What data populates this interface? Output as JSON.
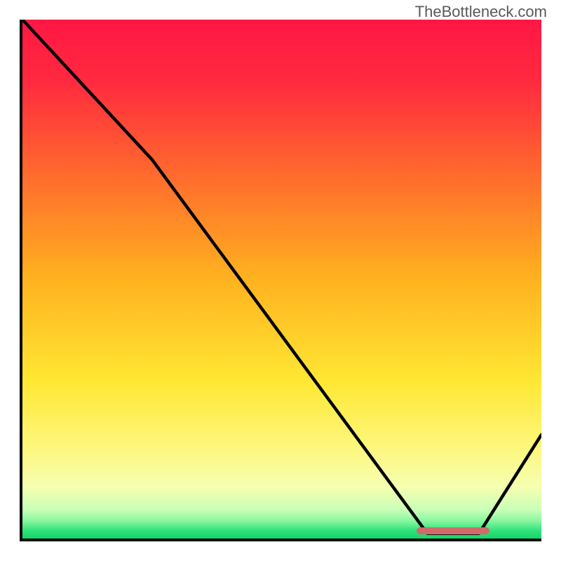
{
  "watermark": "TheBottleneck.com",
  "chart_data": {
    "type": "line",
    "title": "",
    "xlabel": "",
    "ylabel": "",
    "xlim": [
      0,
      100
    ],
    "ylim": [
      0,
      100
    ],
    "x": [
      0,
      25,
      78,
      88,
      100
    ],
    "values": [
      100,
      73,
      1,
      1,
      20
    ],
    "gradient_stops": [
      {
        "pos": 0.0,
        "color": "#ff1744"
      },
      {
        "pos": 0.12,
        "color": "#ff2a3f"
      },
      {
        "pos": 0.3,
        "color": "#ff6b2d"
      },
      {
        "pos": 0.5,
        "color": "#ffb21f"
      },
      {
        "pos": 0.7,
        "color": "#ffe834"
      },
      {
        "pos": 0.82,
        "color": "#fdf67a"
      },
      {
        "pos": 0.9,
        "color": "#f6ffb0"
      },
      {
        "pos": 0.945,
        "color": "#c8ffb8"
      },
      {
        "pos": 0.965,
        "color": "#8cf7a0"
      },
      {
        "pos": 0.985,
        "color": "#2fe27a"
      },
      {
        "pos": 1.0,
        "color": "#17d56a"
      }
    ],
    "marker": {
      "x_start": 76,
      "x_end": 90,
      "y": 1.5,
      "color": "#d16a6a"
    }
  }
}
